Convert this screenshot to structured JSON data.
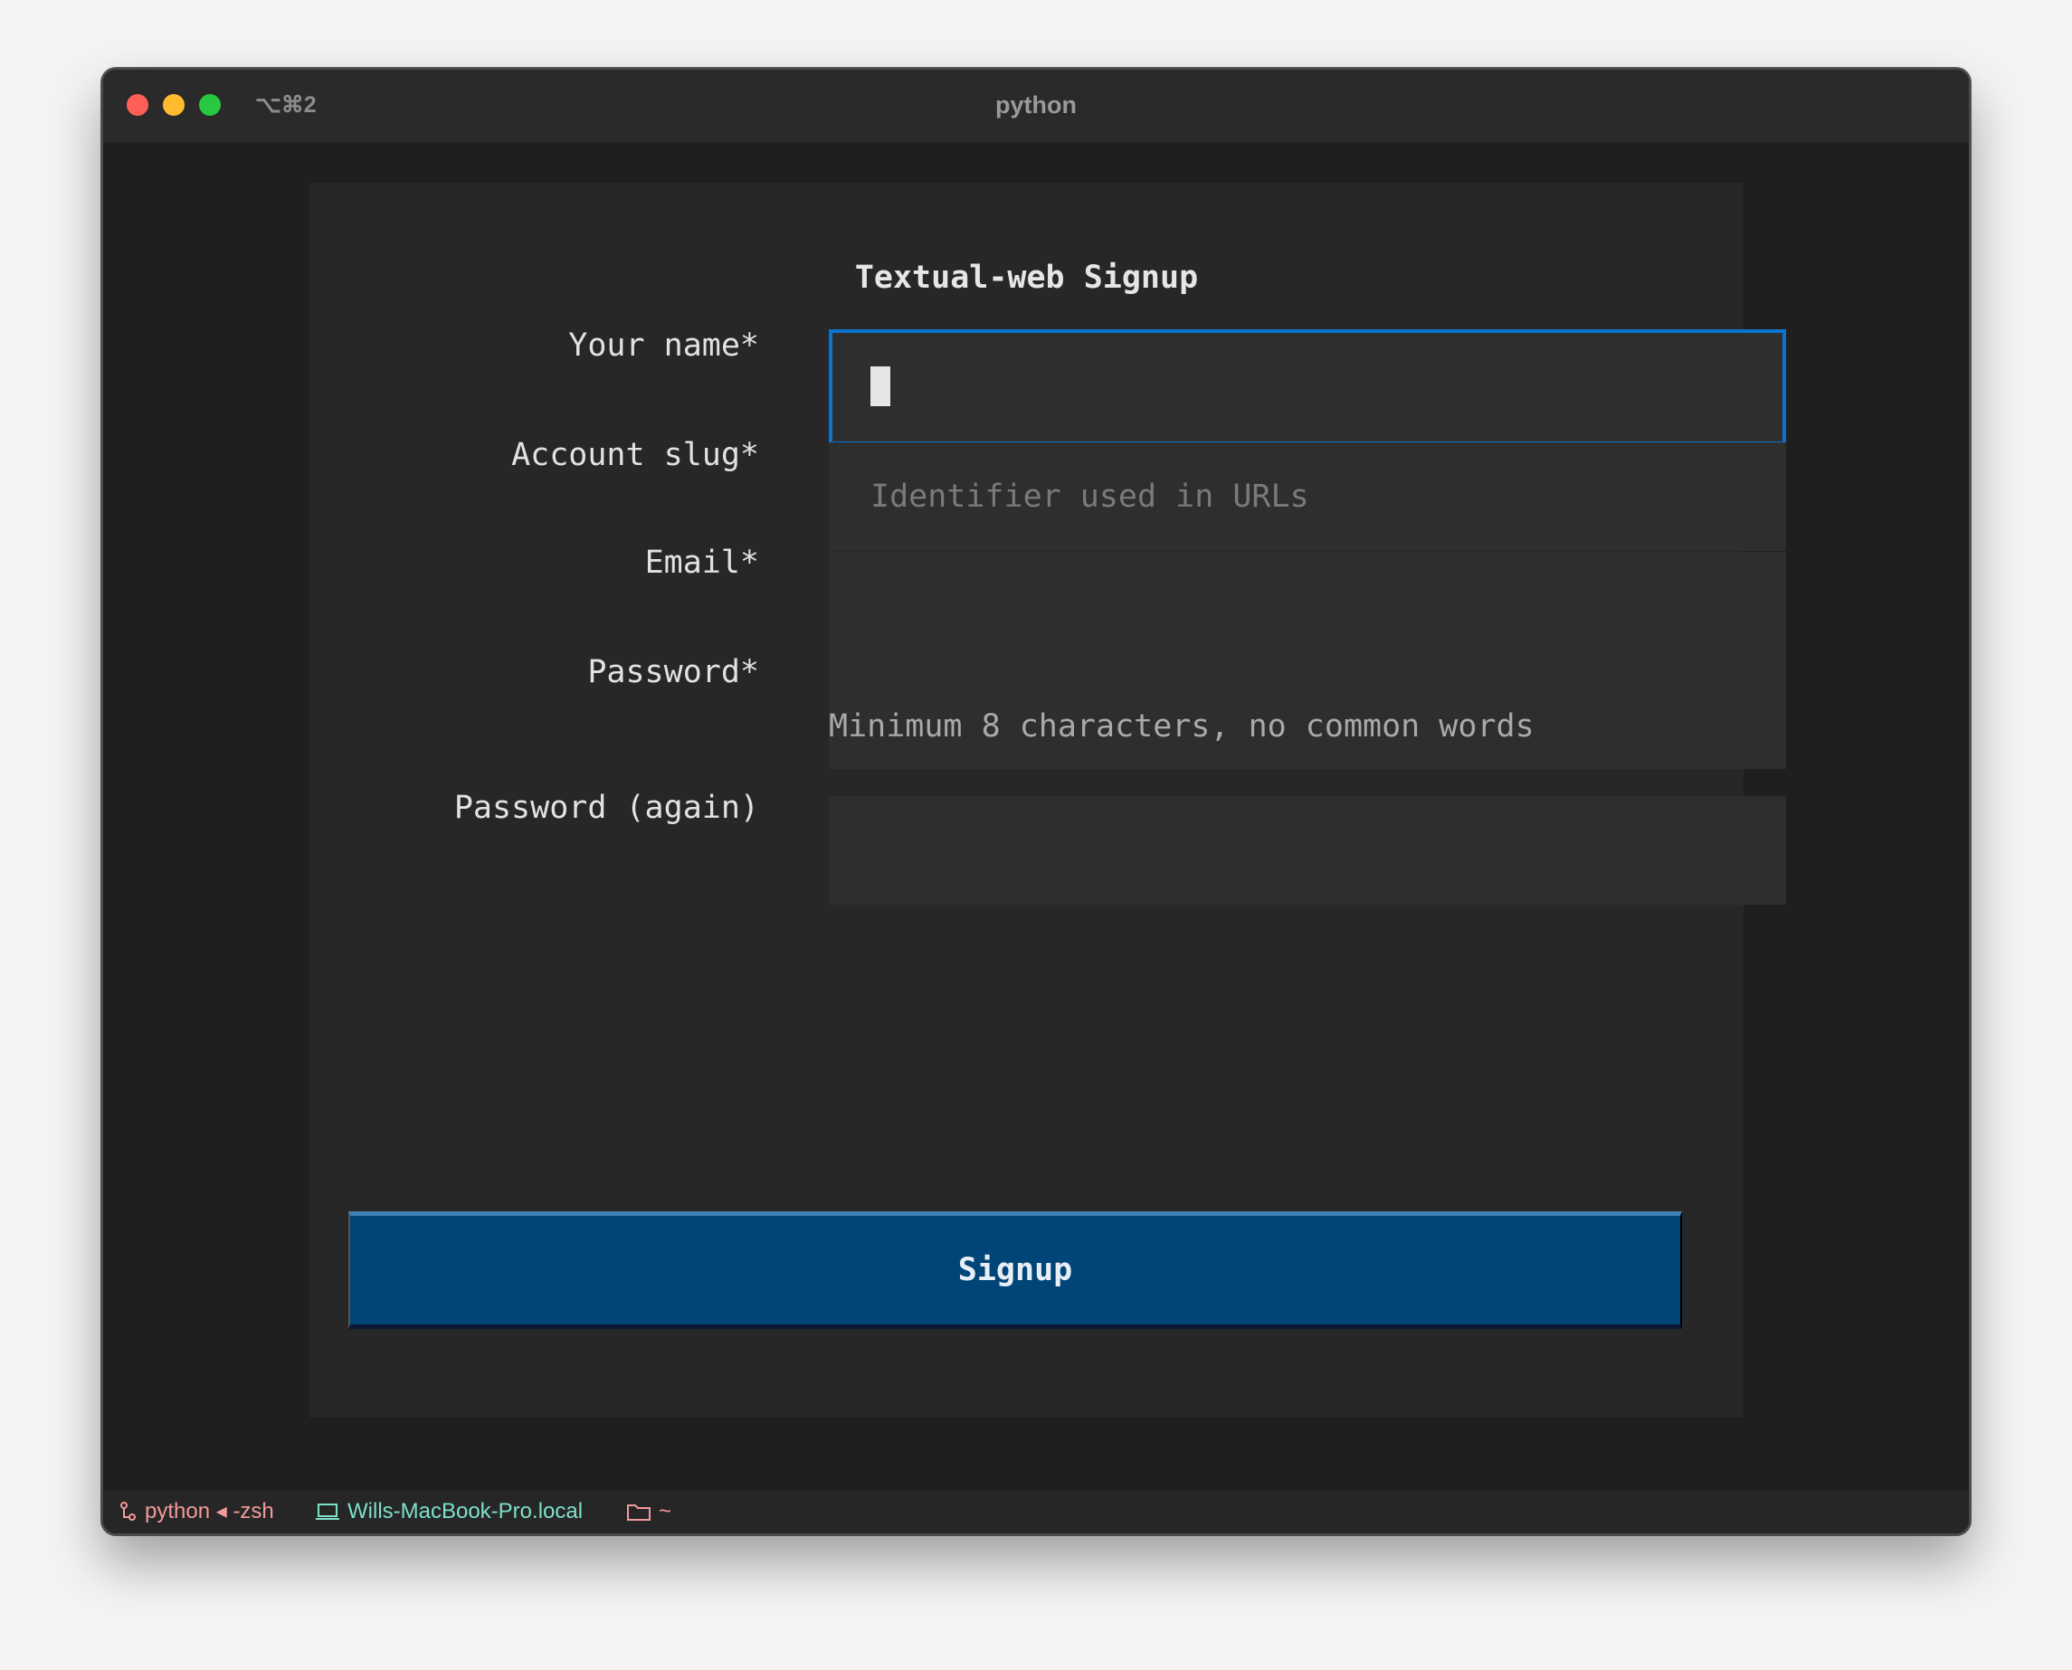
{
  "window": {
    "title": "python",
    "shortcut": "⌥⌘2"
  },
  "form": {
    "title": "Textual-web Signup",
    "fields": [
      {
        "label": "Your name*",
        "value": "",
        "placeholder": "",
        "focused": true
      },
      {
        "label": "Account slug*",
        "value": "",
        "placeholder": "Identifier used in URLs"
      },
      {
        "label": "Email*",
        "value": "",
        "placeholder": ""
      },
      {
        "label": "Password*",
        "value": "",
        "placeholder": "",
        "hint": "Minimum 8 characters, no common words"
      },
      {
        "label": "Password (again)",
        "value": "",
        "placeholder": ""
      }
    ],
    "submit_label": "Signup"
  },
  "statusbar": {
    "process": "python ◂ -zsh",
    "host": "Wills-MacBook-Pro.local",
    "directory": "~"
  },
  "colors": {
    "focus_border": "#0a74d0",
    "button_bg": "#004578",
    "status_pink": "#f39a9a",
    "status_teal": "#7ee0c8"
  }
}
